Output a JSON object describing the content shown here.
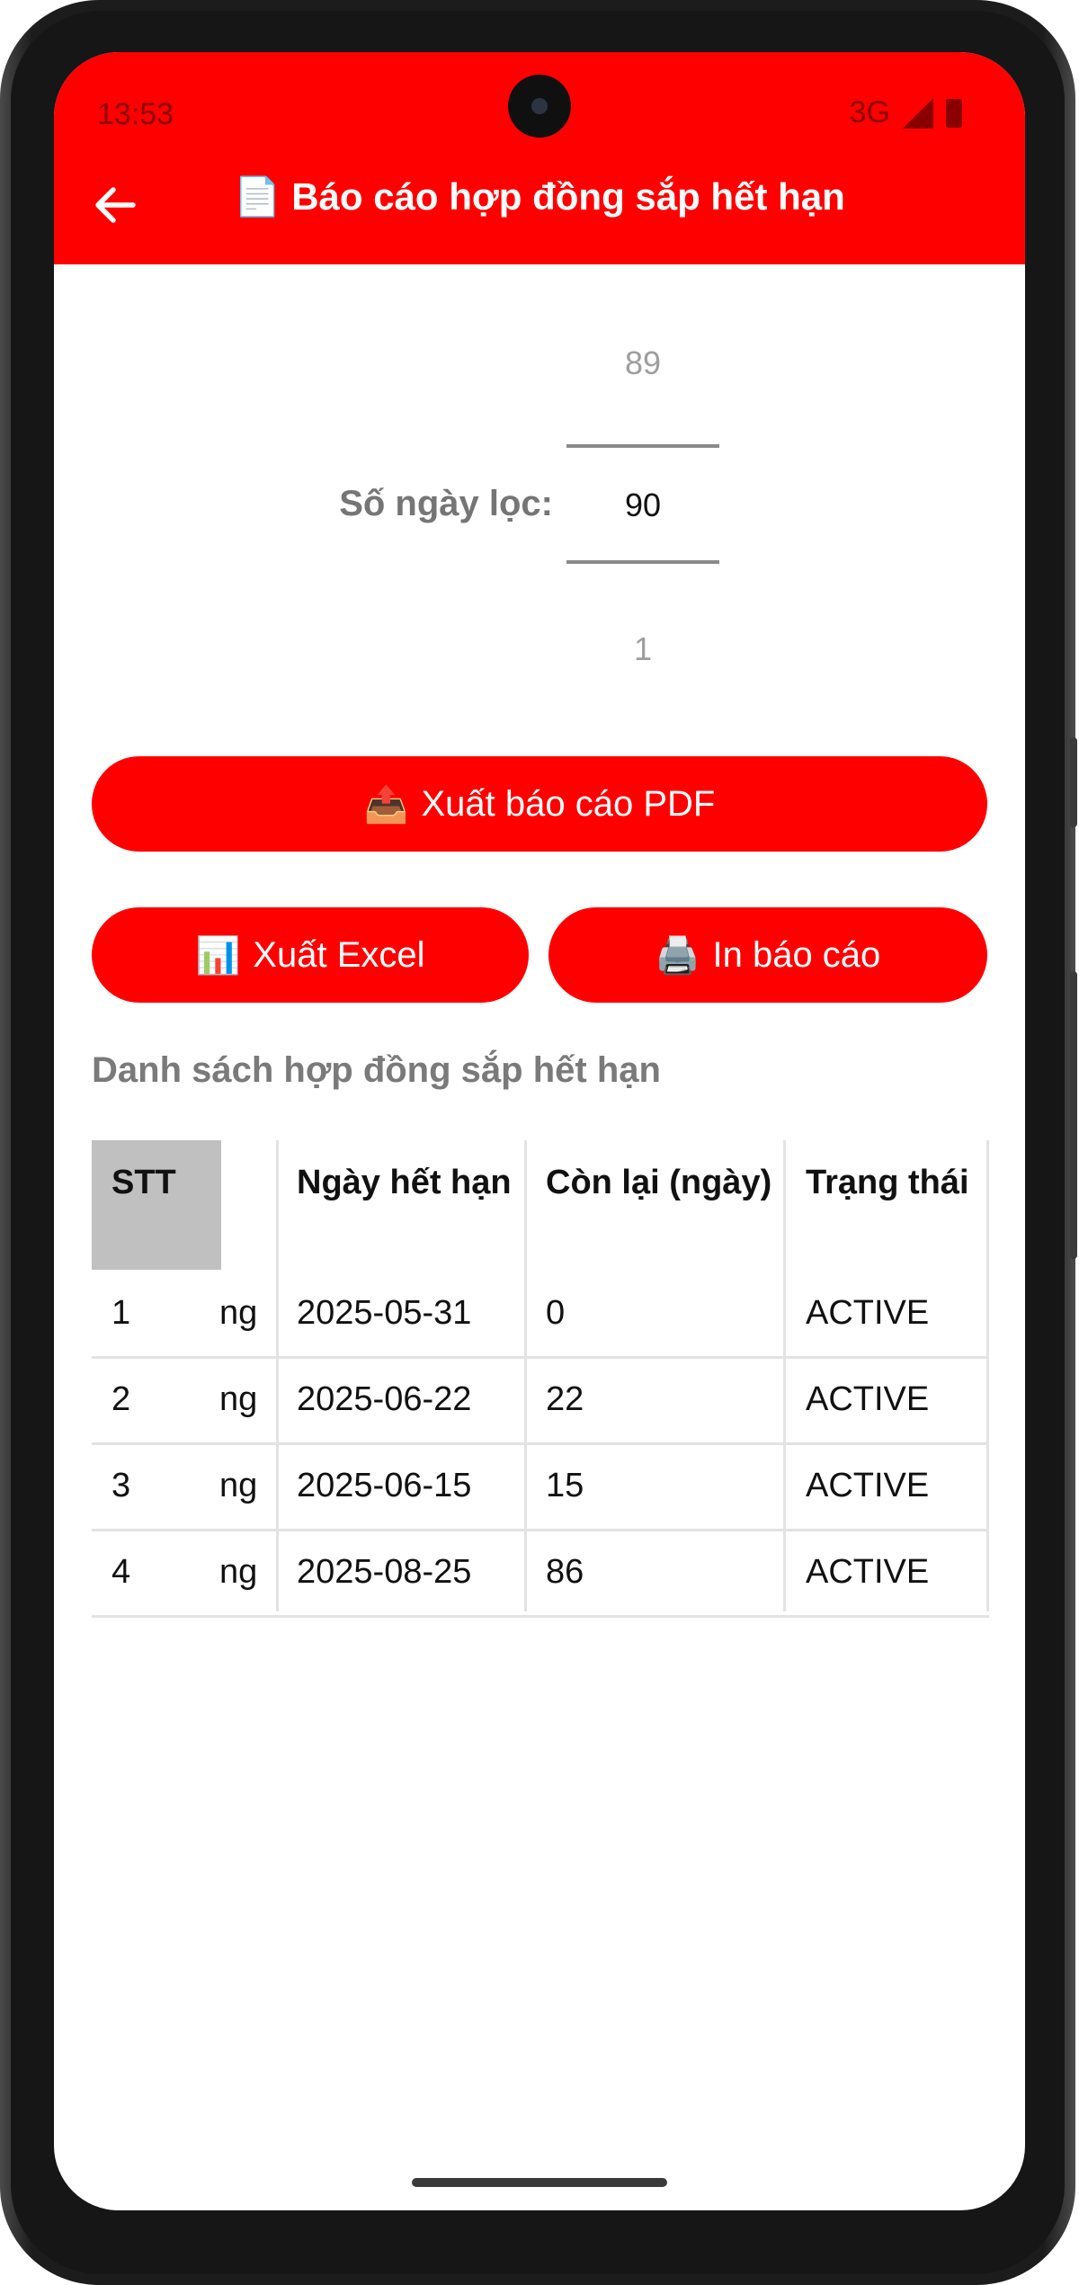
{
  "status_bar": {
    "time": "13:53",
    "network": "3G"
  },
  "app_bar": {
    "title_emoji": "📄",
    "title": "Báo cáo hợp đồng sắp hết hạn"
  },
  "filter": {
    "label": "Số ngày lọc:",
    "picker_prev": "89",
    "picker_value": "90",
    "picker_next": "1"
  },
  "buttons": {
    "export_pdf": {
      "emoji": "📤",
      "label": "Xuất báo cáo PDF"
    },
    "export_excel": {
      "emoji": "📊",
      "label": "Xuất Excel"
    },
    "print": {
      "emoji": "🖨️",
      "label": "In báo cáo"
    }
  },
  "list": {
    "title": "Danh sách hợp đồng sắp hết hạn",
    "columns": [
      "STT",
      "Ngày hết hạn",
      "Còn lại (ngày)",
      "Trạng thái"
    ],
    "rows": [
      {
        "stt": "1",
        "clipped": "ng",
        "expiry": "2025-05-31",
        "remaining": "0",
        "status": "ACTIVE"
      },
      {
        "stt": "2",
        "clipped": "ng",
        "expiry": "2025-06-22",
        "remaining": "22",
        "status": "ACTIVE"
      },
      {
        "stt": "3",
        "clipped": "ng",
        "expiry": "2025-06-15",
        "remaining": "15",
        "status": "ACTIVE"
      },
      {
        "stt": "4",
        "clipped": "ng",
        "expiry": "2025-08-25",
        "remaining": "86",
        "status": "ACTIVE"
      }
    ]
  },
  "colors": {
    "accent": "#ff0000",
    "label_gray": "#757575",
    "header_cell_bg": "#c0c0c0"
  }
}
